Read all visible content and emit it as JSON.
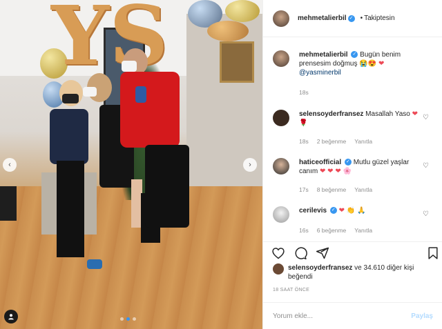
{
  "post": {
    "author": "mehmetalierbil",
    "follow_status": "Takiptesin",
    "follow_dot": "•",
    "caption_text": "Bugün benim prensesim doğmuş",
    "caption_emojis": "😭😍",
    "caption_heart": "❤",
    "caption_mention": "@yasminerbil",
    "caption_time": "18s"
  },
  "comments": [
    {
      "user": "selensoyderfransez",
      "text": "Masallah Yaso",
      "emojis": "❤ 🌹",
      "time": "18s",
      "likes": "2 beğenme",
      "reply": "Yanıtla",
      "verified": false,
      "avatar_color": "#3b2a20"
    },
    {
      "user": "haticeofficial",
      "text": "Mutlu güzel yaşlar canım",
      "emojis": "❤ ❤ ❤ 🌸",
      "time": "17s",
      "likes": "8 beğenme",
      "reply": "Yanıtla",
      "verified": true,
      "avatar_color": "#2c2c2c"
    },
    {
      "user": "cerilevis",
      "text": "",
      "emojis": "❤ 👏 🙏",
      "time": "16s",
      "likes": "6 beğenme",
      "reply": "Yanıtla",
      "verified": true,
      "avatar_color": "#d9d9d9"
    }
  ],
  "liked_by": {
    "user": "selensoyderfransez",
    "rest": "ve 34.610 diğer kişi beğendi"
  },
  "time_ago": "18 SAAT ÖNCE",
  "add_comment": {
    "placeholder": "Yorum ekle...",
    "post_label": "Paylaş"
  },
  "photo": {
    "balloon_letters": "YS",
    "carousel_index": 2,
    "carousel_total": 3
  },
  "colors": {
    "accent": "#3897f0",
    "heart": "#ed4956",
    "muted": "#8e8e8e"
  },
  "icons": [
    "heart-icon",
    "comment-icon",
    "share-icon",
    "bookmark-icon",
    "chevron-left-icon",
    "chevron-right-icon",
    "user-tag-icon",
    "verified-icon"
  ]
}
